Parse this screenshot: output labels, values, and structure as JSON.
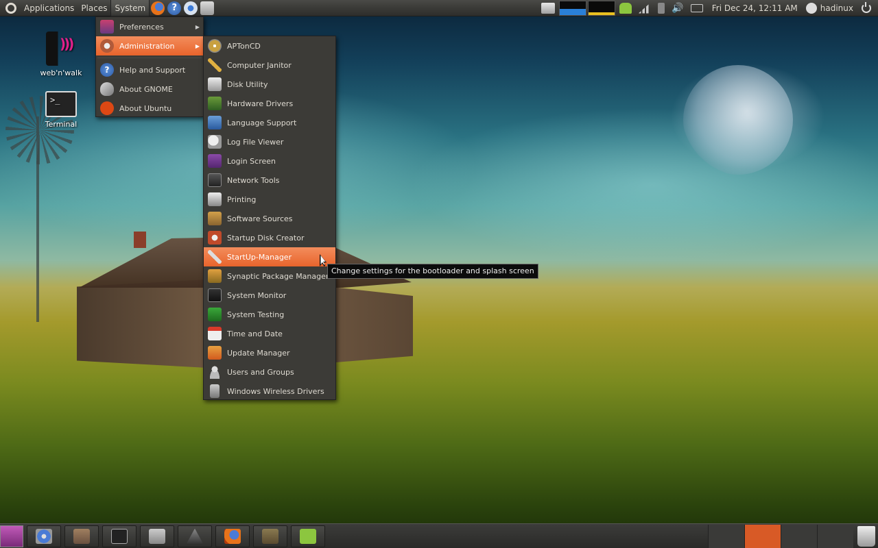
{
  "top_panel": {
    "menus": [
      "Applications",
      "Places",
      "System"
    ],
    "clock": "Fri Dec 24, 12:11 AM",
    "username": "hadinux"
  },
  "desktop_icons": [
    {
      "label": "web'n'walk",
      "icon": "webnwalk-icon"
    },
    {
      "label": "Terminal",
      "icon": "terminal-icon"
    }
  ],
  "terminal_prompt": ">_",
  "system_menu": {
    "items": [
      {
        "label": "Preferences",
        "icon": "preferences-icon",
        "has_submenu": true
      },
      {
        "label": "Administration",
        "icon": "administration-icon",
        "has_submenu": true,
        "highlighted": true
      },
      {
        "label": "Help and Support",
        "icon": "help-icon"
      },
      {
        "label": "About GNOME",
        "icon": "gnome-foot-icon"
      },
      {
        "label": "About Ubuntu",
        "icon": "ubuntu-icon"
      }
    ]
  },
  "admin_menu": {
    "items": [
      {
        "label": "APTonCD",
        "icon": "aptoncd-icon"
      },
      {
        "label": "Computer Janitor",
        "icon": "broom-icon"
      },
      {
        "label": "Disk Utility",
        "icon": "disk-icon"
      },
      {
        "label": "Hardware Drivers",
        "icon": "chip-icon"
      },
      {
        "label": "Language Support",
        "icon": "globe-icon"
      },
      {
        "label": "Log File Viewer",
        "icon": "magnifier-icon"
      },
      {
        "label": "Login Screen",
        "icon": "login-icon"
      },
      {
        "label": "Network Tools",
        "icon": "network-icon"
      },
      {
        "label": "Printing",
        "icon": "printer-icon"
      },
      {
        "label": "Software Sources",
        "icon": "software-sources-icon"
      },
      {
        "label": "Startup Disk Creator",
        "icon": "startup-disk-icon"
      },
      {
        "label": "StartUp-Manager",
        "icon": "wrench-icon",
        "highlighted": true
      },
      {
        "label": "Synaptic Package Manager",
        "icon": "package-icon"
      },
      {
        "label": "System Monitor",
        "icon": "monitor-graph-icon"
      },
      {
        "label": "System Testing",
        "icon": "checkmark-icon"
      },
      {
        "label": "Time and Date",
        "icon": "calendar-clock-icon"
      },
      {
        "label": "Update Manager",
        "icon": "update-icon"
      },
      {
        "label": "Users and Groups",
        "icon": "users-icon"
      },
      {
        "label": "Windows Wireless Drivers",
        "icon": "wireless-driver-icon"
      }
    ]
  },
  "tooltip": "Change settings for the bootloader and splash screen",
  "colors": {
    "highlight": "#e8642c",
    "menu_bg": "#3c3b37",
    "panel_bg": "#3a3a37",
    "active_workspace": "#d85a26"
  }
}
